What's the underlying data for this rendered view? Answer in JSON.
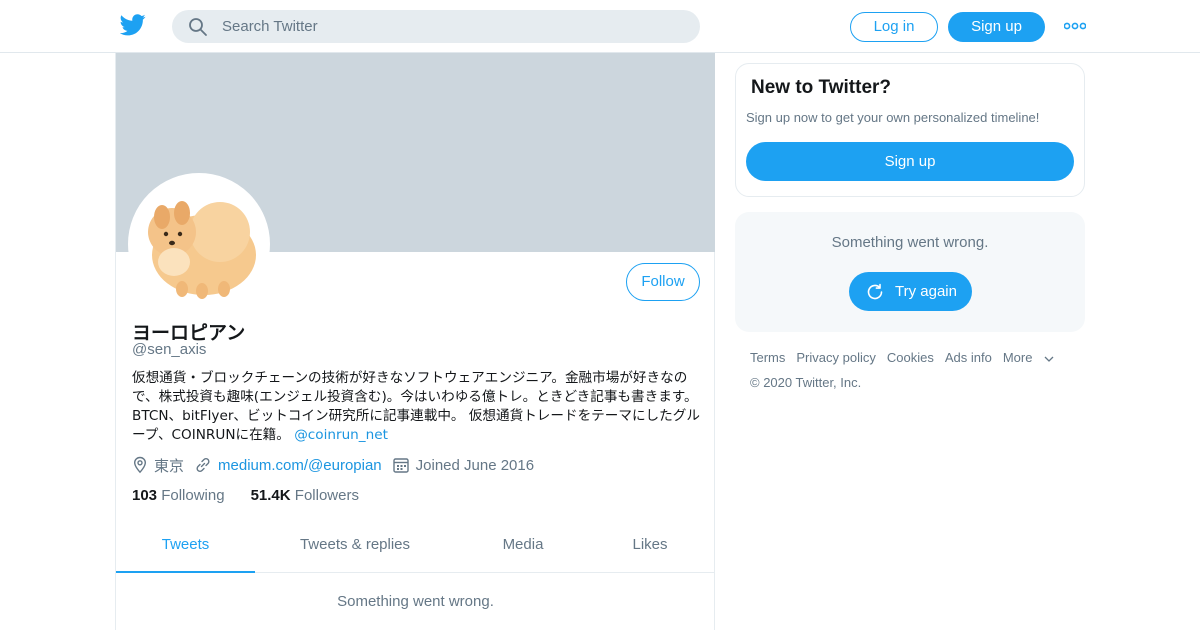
{
  "header": {
    "search_placeholder": "Search Twitter",
    "login_label": "Log in",
    "signup_label": "Sign up"
  },
  "profile": {
    "follow_label": "Follow",
    "name": "ヨーロピアン",
    "handle": "@sen_axis",
    "bio_text": "仮想通貨・ブロックチェーンの技術が好きなソフトウェアエンジニア。金融市場が好きなので、株式投資も趣味(エンジェル投資含む)。今はいわゆる億トレ。ときどき記事も書きます。BTCN、bitFlyer、ビットコイン研究所に記事連載中。 仮想通貨トレードをテーマにしたグループ、COINRUNに在籍。",
    "bio_mention": "@coinrun_net",
    "location": "東京",
    "website": "medium.com/@europian",
    "joined": "Joined June 2016",
    "following_count": "103",
    "following_label": "Following",
    "followers_count": "51.4K",
    "followers_label": "Followers"
  },
  "tabs": [
    "Tweets",
    "Tweets & replies",
    "Media",
    "Likes"
  ],
  "timeline": {
    "error_message": "Something went wrong."
  },
  "sidebar": {
    "new_title": "New to Twitter?",
    "new_subtitle": "Sign up now to get your own personalized timeline!",
    "new_signup_label": "Sign up",
    "error_message": "Something went wrong.",
    "try_again_label": "Try again"
  },
  "footer": {
    "links": [
      "Terms",
      "Privacy policy",
      "Cookies",
      "Ads info"
    ],
    "more_label": "More",
    "copyright": "© 2020 Twitter, Inc."
  },
  "colors": {
    "brand_blue": "#1da1f2",
    "link_blue": "#1b95e0",
    "muted_text": "#657786",
    "banner_gray": "#ccd6dd"
  }
}
